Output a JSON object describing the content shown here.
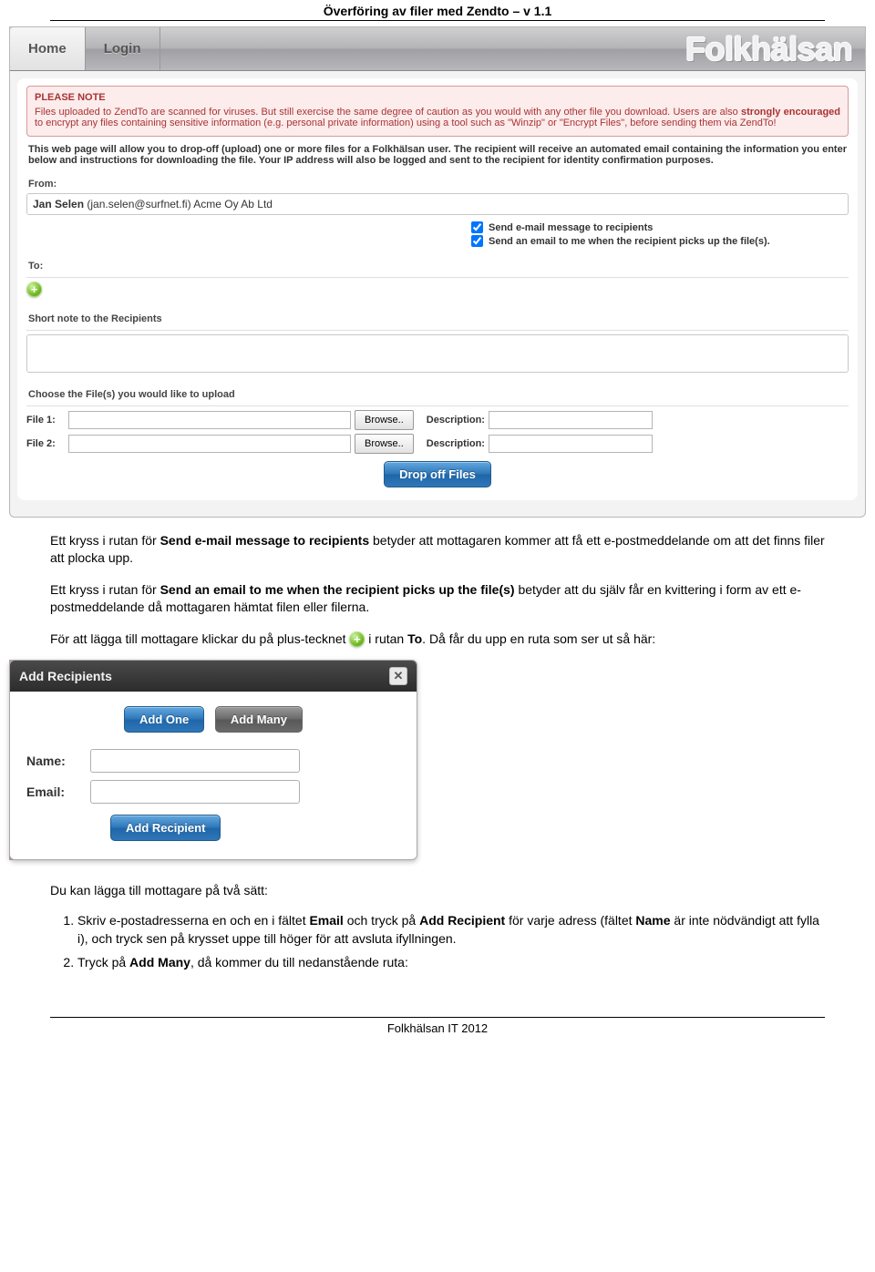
{
  "docTitle": "Överföring av filer med Zendto – v 1.1",
  "header": {
    "tabHome": "Home",
    "tabLogin": "Login",
    "brand": "Folkhälsan"
  },
  "notice": {
    "head": "PLEASE NOTE",
    "line1a": "Files uploaded to ZendTo are scanned for viruses. But still exercise the same degree of caution as you would with any other file you download. Users are also ",
    "line1b": "strongly encouraged",
    "line1c": " to encrypt any files containing sensitive information (e.g. personal private information) using a tool such as \"Winzip\" or \"Encrypt Files\", before sending them via ZendTo!"
  },
  "intro": "This web page will allow you to drop-off (upload) one or more files for a Folkhälsan user. The recipient will receive an automated email containing the information you enter below and instructions for downloading the file. Your IP address will also be logged and sent to the recipient for identity confirmation purposes.",
  "from": {
    "label": "From:",
    "name": "Jan Selen",
    "detail": "  (jan.selen@surfnet.fi)  Acme Oy Ab Ltd"
  },
  "options": {
    "opt1": "Send e-mail message to recipients",
    "opt2": "Send an email to me when the recipient picks up the file(s)."
  },
  "to": {
    "label": "To:"
  },
  "shortNote": "Short note to the Recipients",
  "chooseFiles": "Choose the File(s) you would like to upload",
  "fileRows": {
    "file1": "File 1:",
    "file2": "File 2:",
    "browse": "Browse..",
    "desc": "Description:"
  },
  "dropoffBtn": "Drop off Files",
  "body": {
    "p1a": "Ett kryss i rutan för ",
    "p1b": "Send e-mail message to recipients",
    "p1c": " betyder att mottagaren kommer att få ett e-postmeddelande om att det finns filer att plocka upp.",
    "p2a": "Ett kryss i rutan för ",
    "p2b": "Send an email to me when the recipient picks up the file(s)",
    "p2c": " betyder att du själv får en kvittering i form av ett e-postmeddelande då mottagaren hämtat filen eller filerna.",
    "p3a": "För att lägga till mottagare klickar du på plus-tecknet ",
    "p3b": " i rutan ",
    "p3c": "To",
    "p3d": ". Då får du upp en ruta som ser ut så här:"
  },
  "dialog": {
    "title": "Add Recipients",
    "addOne": "Add One",
    "addMany": "Add Many",
    "nameLabel": "Name:",
    "emailLabel": "Email:",
    "addRecipient": "Add Recipient"
  },
  "afterDlg": "Du kan lägga till mottagare på två sätt:",
  "list": {
    "i1a": "Skriv e-postadresserna en och en i fältet ",
    "i1b": "Email",
    "i1c": " och tryck på ",
    "i1d": "Add Recipient",
    "i1e": " för varje adress (fältet ",
    "i1f": "Name",
    "i1g": " är inte nödvändigt att fylla i), och tryck sen på krysset uppe till höger för att avsluta ifyllningen.",
    "i2a": "Tryck på ",
    "i2b": "Add Many",
    "i2c": ", då kommer du till nedanstående ruta:"
  },
  "footer": "Folkhälsan IT 2012"
}
